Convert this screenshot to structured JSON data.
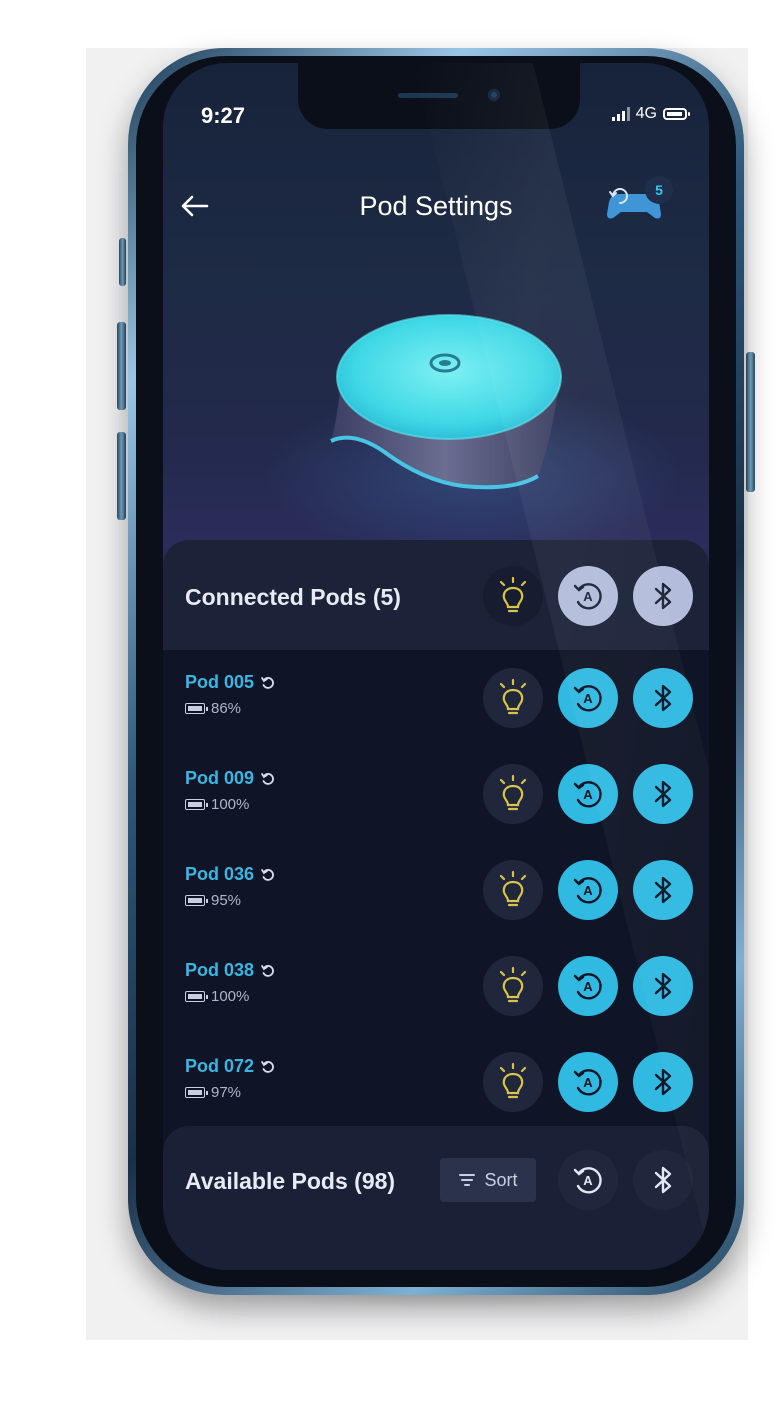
{
  "status_bar": {
    "time": "9:27",
    "network": "4G"
  },
  "header": {
    "title": "Pod Settings",
    "gamepad_badge": "5"
  },
  "connected": {
    "title": "Connected Pods (5)",
    "pods": [
      {
        "name": "Pod 005",
        "battery": "86%"
      },
      {
        "name": "Pod 009",
        "battery": "100%"
      },
      {
        "name": "Pod 036",
        "battery": "95%"
      },
      {
        "name": "Pod 038",
        "battery": "100%"
      },
      {
        "name": "Pod 072",
        "battery": "97%"
      }
    ]
  },
  "available": {
    "title": "Available Pods (98)",
    "sort_label": "Sort"
  },
  "colors": {
    "accent": "#30b9e1",
    "background": "#0f1426",
    "muted_button": "#b3bddb"
  },
  "icons": [
    "back-arrow-icon",
    "gamepad-icon",
    "bulb-icon",
    "auto-rotate-icon",
    "bluetooth-icon",
    "refresh-icon",
    "battery-icon",
    "sort-icon"
  ]
}
